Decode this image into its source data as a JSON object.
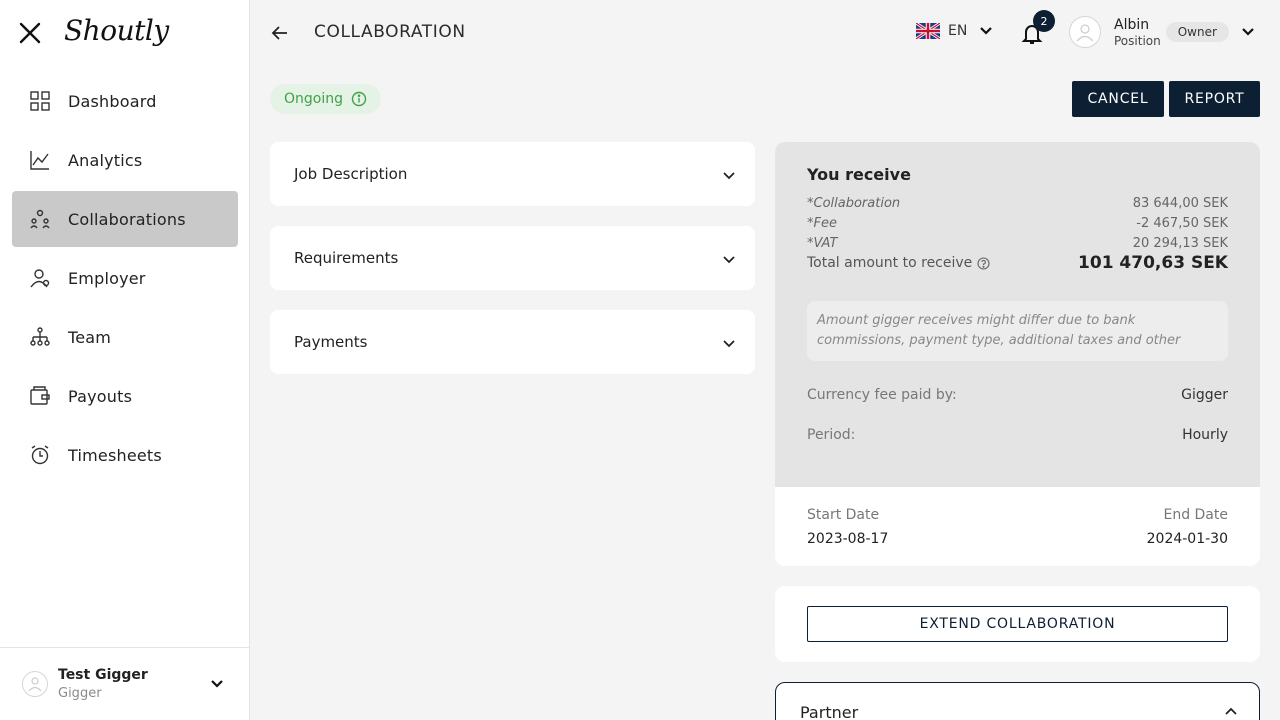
{
  "app": {
    "logo_text": "Shoutly"
  },
  "sidebar": {
    "items": [
      {
        "label": "Dashboard",
        "icon": "dashboard-icon"
      },
      {
        "label": "Analytics",
        "icon": "analytics-icon"
      },
      {
        "label": "Collaborations",
        "icon": "collaborations-icon",
        "active": true
      },
      {
        "label": "Employer",
        "icon": "employer-icon"
      },
      {
        "label": "Team",
        "icon": "team-icon"
      },
      {
        "label": "Payouts",
        "icon": "payouts-icon"
      },
      {
        "label": "Timesheets",
        "icon": "timesheets-icon"
      }
    ],
    "footer": {
      "name": "Test Gigger",
      "role": "Gigger"
    }
  },
  "header": {
    "title": "COLLABORATION",
    "language": "EN",
    "notification_count": "2",
    "user": {
      "name": "Albin",
      "position": "Position",
      "role": "Owner"
    }
  },
  "status": {
    "label": "Ongoing",
    "color": "#43a047"
  },
  "actions": {
    "cancel_label": "CANCEL",
    "report_label": "REPORT"
  },
  "accordions": [
    {
      "title": "Job Description"
    },
    {
      "title": "Requirements"
    },
    {
      "title": "Payments"
    }
  ],
  "receive": {
    "title": "You receive",
    "lines": [
      {
        "label": "*Collaboration",
        "value": "83 644,00 SEK"
      },
      {
        "label": "*Fee",
        "value": "-2 467,50 SEK"
      },
      {
        "label": "*VAT",
        "value": "20 294,13 SEK"
      }
    ],
    "total_label": "Total amount to receive",
    "total_value": "101 470,63 SEK",
    "note": "Amount gigger receives might differ due to bank commissions, payment type, additional taxes and other",
    "currency_fee_label": "Currency fee paid by:",
    "currency_fee_value": "Gigger",
    "period_label": "Period:",
    "period_value": "Hourly",
    "start_label": "Start Date",
    "start_value": "2023-08-17",
    "end_label": "End Date",
    "end_value": "2024-01-30"
  },
  "extend_label": "EXTEND COLLABORATION",
  "partner": {
    "title": "Partner"
  },
  "colors": {
    "primary": "#0d1f33",
    "active_nav": "#c9c9c9",
    "status_bg": "#e4f3e6"
  }
}
